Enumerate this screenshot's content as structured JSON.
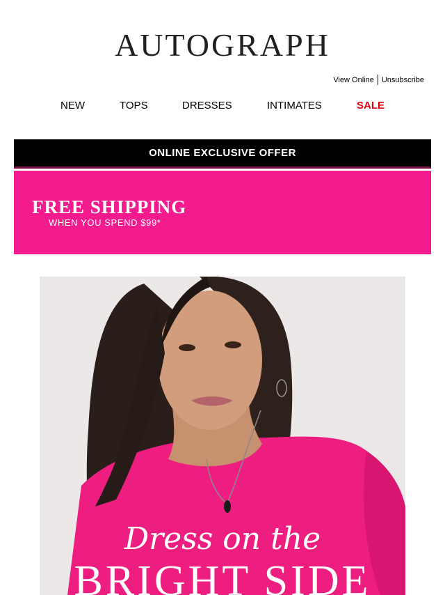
{
  "header": {
    "brand": "AUTOGRAPH",
    "view_online": "View Online",
    "unsubscribe": "Unsubscribe"
  },
  "nav": {
    "items": [
      {
        "label": "NEW"
      },
      {
        "label": "TOPS"
      },
      {
        "label": "DRESSES"
      },
      {
        "label": "INTIMATES"
      },
      {
        "label": "SALE"
      }
    ]
  },
  "offer_bar": {
    "label": "ONLINE EXCLUSIVE OFFER"
  },
  "shipping_banner": {
    "title": "FREE SHIPPING",
    "subtitle": "WHEN YOU SPEND $99*"
  },
  "hero": {
    "script_text": "Dress on the",
    "title": "BRIGHT SIDE"
  },
  "colors": {
    "brand_pink": "#f31b8e",
    "sale_red": "#e3000f",
    "offer_bar_bg": "#000000"
  }
}
